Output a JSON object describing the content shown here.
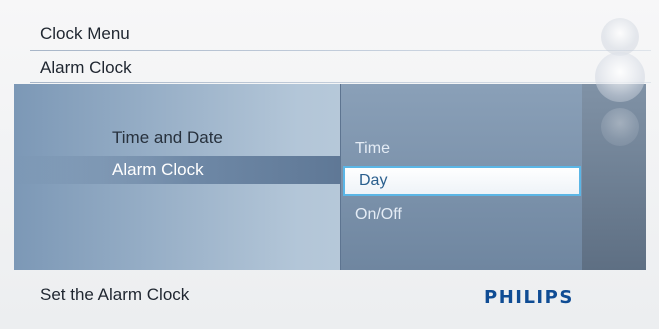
{
  "header": {
    "title": "Clock Menu",
    "subtitle": "Alarm Clock"
  },
  "menu": {
    "items": [
      {
        "label": "Time and Date",
        "selected": false
      },
      {
        "label": "Alarm Clock",
        "selected": true
      }
    ]
  },
  "submenu": {
    "items": [
      {
        "label": "Time",
        "selected": false
      },
      {
        "label": "Day",
        "selected": true
      },
      {
        "label": "On/Off",
        "selected": false
      }
    ]
  },
  "footer": {
    "hint": "Set the Alarm Clock",
    "brand": "PHILIPS"
  },
  "colors": {
    "brand": "#0f4c94",
    "highlight_border": "#5bb6e6"
  },
  "icons": [
    "clock-icon",
    "alarm-icon",
    "settings-icon"
  ]
}
